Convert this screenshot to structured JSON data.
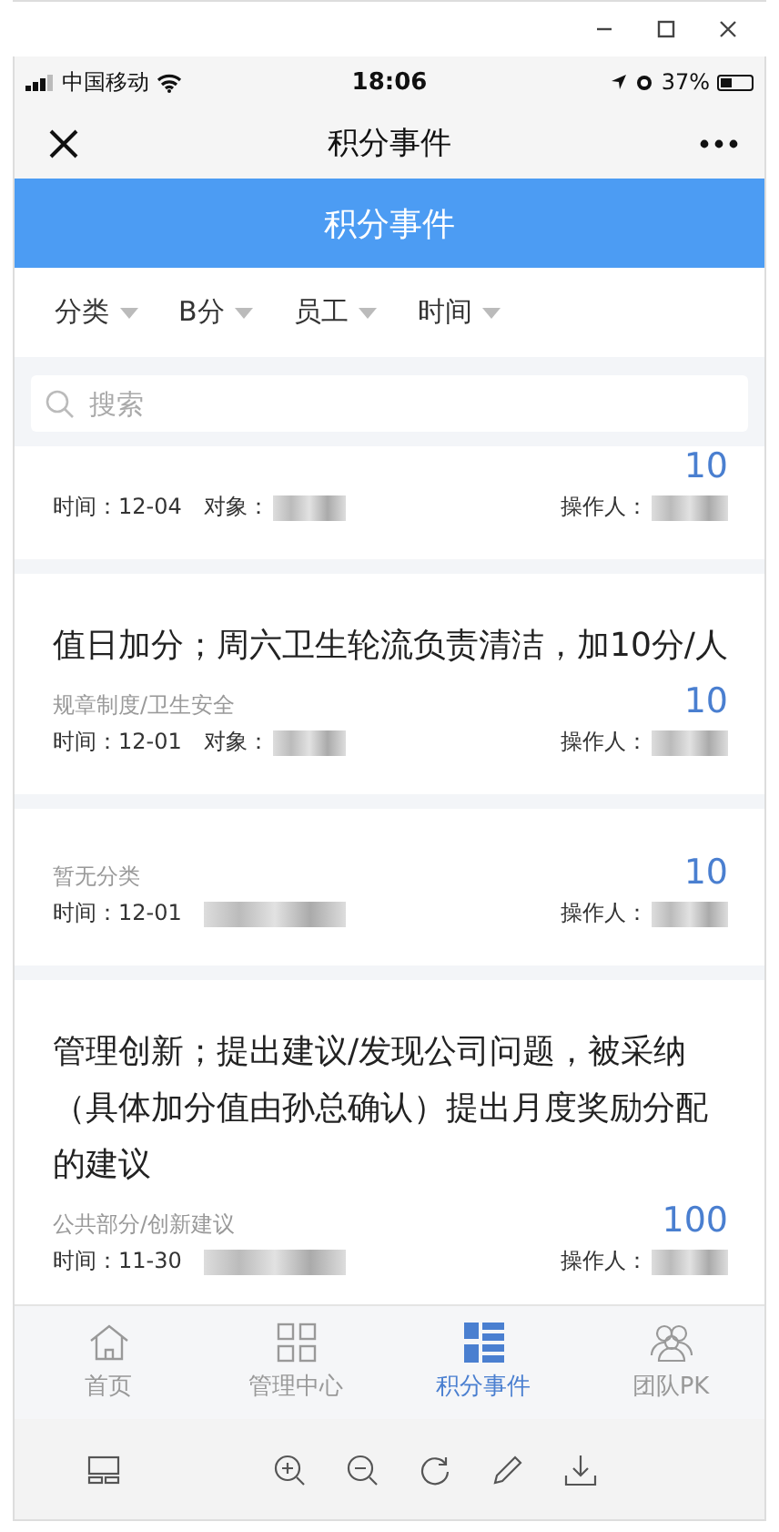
{
  "status_bar": {
    "carrier": "中国移动",
    "time": "18:06",
    "battery": "37%"
  },
  "nav": {
    "title": "积分事件"
  },
  "header": {
    "title": "积分事件"
  },
  "filters": [
    {
      "label": "分类"
    },
    {
      "label": "B分"
    },
    {
      "label": "员工"
    },
    {
      "label": "时间"
    }
  ],
  "search": {
    "placeholder": "搜索"
  },
  "events": [
    {
      "score": "10",
      "time": "时间：12-04",
      "target_label": "对象：",
      "operator_label": "操作人："
    },
    {
      "title": "值日加分；周六卫生轮流负责清洁，加10分/人",
      "category": "规章制度/卫生安全",
      "score": "10",
      "time": "时间：12-01",
      "target_label": "对象：",
      "operator_label": "操作人："
    },
    {
      "category": "暂无分类",
      "score": "10",
      "time": "时间：12-01",
      "operator_label": "操作人："
    },
    {
      "title": "管理创新；提出建议/发现公司问题，被采纳（具体加分值由孙总确认）提出月度奖励分配的建议",
      "category": "公共部分/创新建议",
      "score": "100",
      "time": "时间：11-30",
      "operator_label": "操作人："
    }
  ],
  "tabs": [
    {
      "label": "首页",
      "kind": "home",
      "selected": false
    },
    {
      "label": "管理中心",
      "kind": "grid",
      "selected": false
    },
    {
      "label": "积分事件",
      "kind": "list",
      "selected": true
    },
    {
      "label": "团队PK",
      "kind": "team",
      "selected": false
    }
  ]
}
